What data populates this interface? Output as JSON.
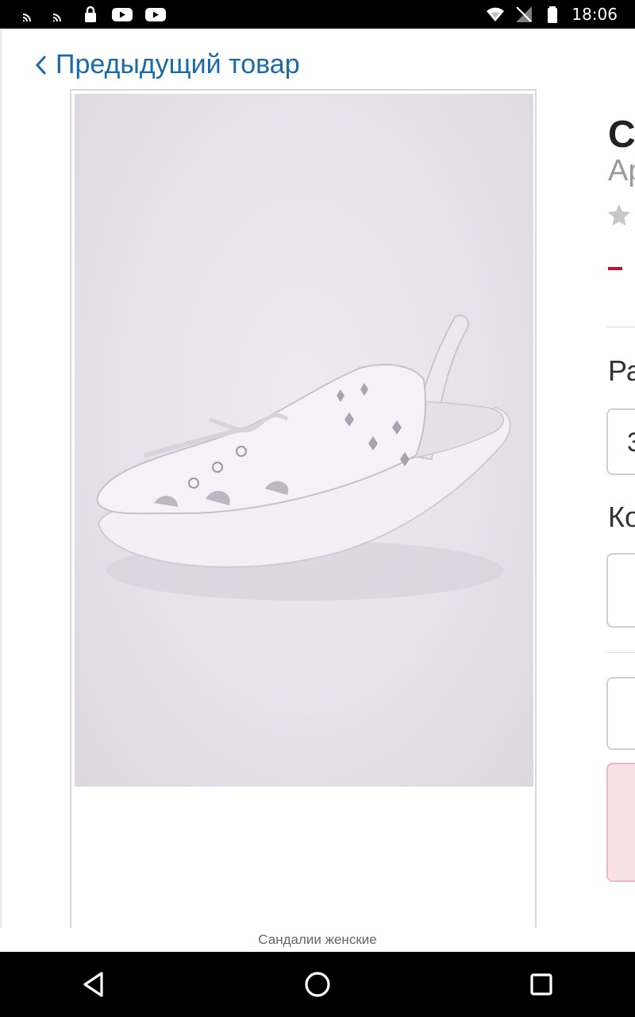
{
  "status_bar": {
    "time": "18:06",
    "left_icons": [
      "cast-icon",
      "cast-icon",
      "lock-icon",
      "youtube-icon",
      "youtube-icon"
    ],
    "right_icons": [
      "wifi-icon",
      "no-signal-icon",
      "battery-icon"
    ]
  },
  "nav": {
    "back_label": "Предыдущий товар"
  },
  "product": {
    "image_alt": "white perforated slingback sandal with laces",
    "title_partial": "С",
    "article_partial": "Ар",
    "price_partial": "-",
    "size_label_partial": "Ра",
    "size_value_partial": "3",
    "qty_label_partial": "Ко"
  },
  "caption": "Сандалии женские",
  "colors": {
    "link": "#1a6aa8",
    "accent_red": "#c8102e",
    "pink_button": "#f9e2e5"
  },
  "system_nav": {
    "buttons": [
      "back-icon",
      "home-icon",
      "recents-icon"
    ]
  }
}
